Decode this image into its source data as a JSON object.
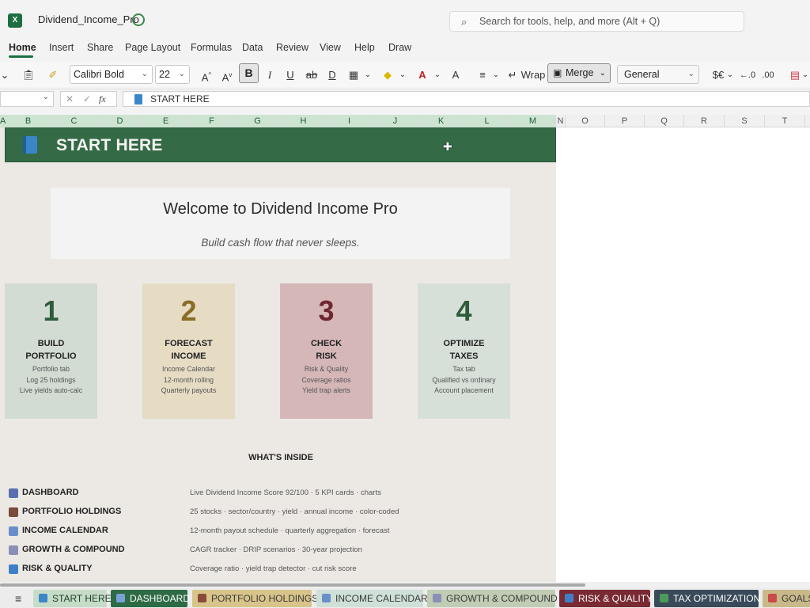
{
  "app": {
    "doc_title": "Dividend_Income_Pro",
    "search_placeholder": "Search for tools, help, and more (Alt + Q)"
  },
  "ribbon_tabs": [
    "Home",
    "Insert",
    "Share",
    "Page Layout",
    "Formulas",
    "Data",
    "Review",
    "View",
    "Help",
    "Draw"
  ],
  "toolbar": {
    "font_name": "Calibri Bold",
    "font_size": "22",
    "bold": "B",
    "italic": "I",
    "underline": "U",
    "wrap": "Wrap",
    "merge": "Merge",
    "number_format": "General",
    "currency": "$€"
  },
  "formula_bar": {
    "fx": "fx",
    "content": "START HERE"
  },
  "columns": [
    "A",
    "B",
    "C",
    "D",
    "E",
    "F",
    "G",
    "H",
    "I",
    "J",
    "K",
    "L",
    "M",
    "N",
    "O",
    "P",
    "Q",
    "R",
    "S",
    "T"
  ],
  "sheet": {
    "banner_title": "START HERE",
    "welcome_title": "Welcome to Dividend Income Pro",
    "welcome_subtitle": "Build cash flow that never sleeps.",
    "steps": [
      {
        "number": "1",
        "title_line1": "BUILD",
        "title_line2": "PORTFOLIO",
        "details": [
          "Portfolio tab",
          "Log 25 holdings",
          "Live yields auto-calc"
        ],
        "bg": "#d2dcd3",
        "color": "#2f5c3b"
      },
      {
        "number": "2",
        "title_line1": "FORECAST",
        "title_line2": "INCOME",
        "details": [
          "Income Calendar",
          "12-month rolling",
          "Quarterly payouts"
        ],
        "bg": "#e6dcc4",
        "color": "#8a6d25"
      },
      {
        "number": "3",
        "title_line1": "CHECK",
        "title_line2": "RISK",
        "details": [
          "Risk & Quality",
          "Coverage ratios",
          "Yield trap alerts"
        ],
        "bg": "#d6b7b8",
        "color": "#6e2732"
      },
      {
        "number": "4",
        "title_line1": "OPTIMIZE",
        "title_line2": "TAXES",
        "details": [
          "Tax tab",
          "Qualified vs ordinary",
          "Account placement"
        ],
        "bg": "#d6e0d8",
        "color": "#2f5c3b"
      }
    ],
    "whats_inside_title": "WHAT'S INSIDE",
    "whats_inside": [
      {
        "label": "DASHBOARD",
        "desc": "Live Dividend Income Score 92/100 · 5 KPI cards · charts",
        "icon_color": "#5b6fb0"
      },
      {
        "label": "PORTFOLIO HOLDINGS",
        "desc": "25 stocks · sector/country · yield · annual income · color-coded",
        "icon_color": "#7a4a3a"
      },
      {
        "label": "INCOME CALENDAR",
        "desc": "12-month payout schedule · quarterly aggregation · forecast",
        "icon_color": "#6a8fc8"
      },
      {
        "label": "GROWTH & COMPOUND",
        "desc": "CAGR tracker · DRIP scenarios · 30-year projection",
        "icon_color": "#8a8fb8"
      },
      {
        "label": "RISK & QUALITY",
        "desc": "Coverage ratio · yield trap detector · cut risk score",
        "icon_color": "#3f7fc8"
      }
    ]
  },
  "sheet_tabs": [
    {
      "label": "START HERE",
      "bg": "#c6dcc8",
      "color": "#1f3f2a",
      "icon": "#3a86c8"
    },
    {
      "label": "DASHBOARD",
      "bg": "#2e6b45",
      "color": "#ffffff",
      "icon": "#7aa0d8"
    },
    {
      "label": "PORTFOLIO HOLDINGS",
      "bg": "#d8c48a",
      "color": "#3a3a3a",
      "icon": "#8a4a3a"
    },
    {
      "label": "INCOME CALENDAR",
      "bg": "#cfe0d8",
      "color": "#3a3a3a",
      "icon": "#6a8fc8"
    },
    {
      "label": "GROWTH & COMPOUND",
      "bg": "#c0cdb4",
      "color": "#3a3a3a",
      "icon": "#8a8fb8"
    },
    {
      "label": "RISK & QUALITY",
      "bg": "#7a2a33",
      "color": "#ffffff",
      "icon": "#3f7fc8"
    },
    {
      "label": "TAX OPTIMIZATION",
      "bg": "#3a4a5a",
      "color": "#ffffff",
      "icon": "#4a9a5a"
    },
    {
      "label": "GOALS",
      "bg": "#c9b98a",
      "color": "#3a3a3a",
      "icon": "#c84a4a"
    }
  ]
}
